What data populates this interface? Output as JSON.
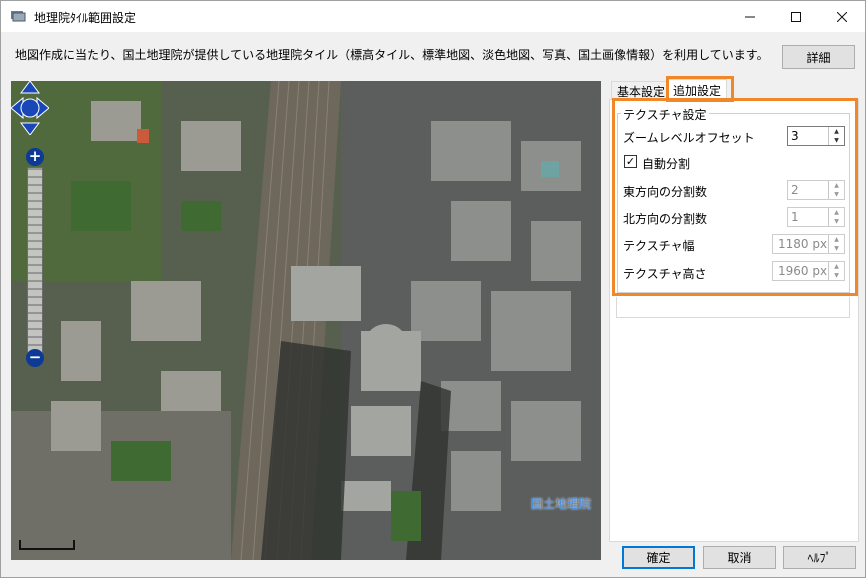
{
  "window": {
    "title": "地理院ﾀｲﾙ範囲設定",
    "minimize_icon": "minimize-icon",
    "maximize_icon": "maximize-icon",
    "close_icon": "close-icon"
  },
  "description": "地図作成に当たり、国土地理院が提供している地理院タイル（標高タイル、標準地図、淡色地図、写真、国土画像情報）を利用しています。",
  "detail_button": "詳細",
  "map": {
    "credit": "国土地理院",
    "scale_label": "",
    "pan_icon": "pan-arrows-icon",
    "zoom_in_label": "+",
    "zoom_out_label": "−",
    "highlight_color": "#f0882a"
  },
  "tabs": [
    {
      "label": "基本設定",
      "selected": false
    },
    {
      "label": "追加設定",
      "selected": true
    }
  ],
  "texture": {
    "group_title": "テクスチャ設定",
    "zoom_offset_label": "ズームレベルオフセット",
    "zoom_offset_value": "3",
    "auto_split_label": "自動分割",
    "auto_split_checked": true,
    "east_split_label": "東方向の分割数",
    "east_split_value": "2",
    "north_split_label": "北方向の分割数",
    "north_split_value": "1",
    "width_label": "テクスチャ幅",
    "width_value": "1180 px",
    "height_label": "テクスチャ高さ",
    "height_value": "1960 px"
  },
  "buttons": {
    "ok": "確定",
    "cancel": "取消",
    "help": "ﾍﾙﾌﾟ"
  }
}
